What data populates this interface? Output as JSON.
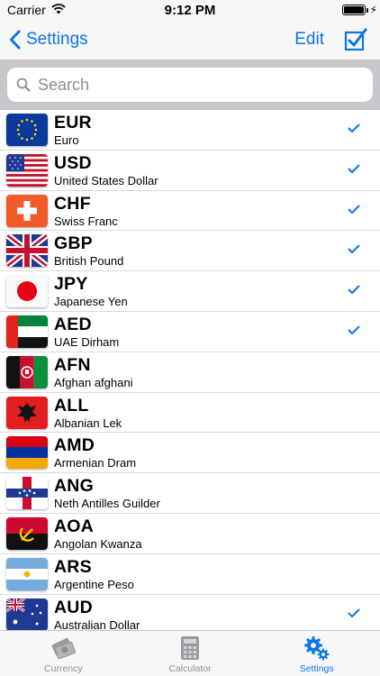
{
  "status": {
    "carrier": "Carrier",
    "time": "9:12 PM"
  },
  "nav": {
    "back_label": "Settings",
    "edit_label": "Edit"
  },
  "search": {
    "placeholder": "Search",
    "value": ""
  },
  "currencies": [
    {
      "code": "EUR",
      "name": "Euro",
      "checked": true,
      "flag": "eu-flag-icon"
    },
    {
      "code": "USD",
      "name": "United States Dollar",
      "checked": true,
      "flag": "us-flag-icon"
    },
    {
      "code": "CHF",
      "name": "Swiss Franc",
      "checked": true,
      "flag": "swiss-flag-icon"
    },
    {
      "code": "GBP",
      "name": "British Pound",
      "checked": true,
      "flag": "uk-flag-icon"
    },
    {
      "code": "JPY",
      "name": "Japanese Yen",
      "checked": true,
      "flag": "japan-flag-icon"
    },
    {
      "code": "AED",
      "name": "UAE Dirham",
      "checked": true,
      "flag": "uae-flag-icon"
    },
    {
      "code": "AFN",
      "name": "Afghan afghani",
      "checked": false,
      "flag": "afghanistan-flag-icon"
    },
    {
      "code": "ALL",
      "name": "Albanian Lek",
      "checked": false,
      "flag": "albania-flag-icon"
    },
    {
      "code": "AMD",
      "name": "Armenian Dram",
      "checked": false,
      "flag": "armenia-flag-icon"
    },
    {
      "code": "ANG",
      "name": "Neth Antilles Guilder",
      "checked": false,
      "flag": "netherlands-antilles-flag-icon"
    },
    {
      "code": "AOA",
      "name": "Angolan Kwanza",
      "checked": false,
      "flag": "angola-flag-icon"
    },
    {
      "code": "ARS",
      "name": "Argentine Peso",
      "checked": false,
      "flag": "argentina-flag-icon"
    },
    {
      "code": "AUD",
      "name": "Australian Dollar",
      "checked": true,
      "flag": "australia-flag-icon"
    }
  ],
  "tabs": [
    {
      "label": "Currency",
      "icon": "currency-icon",
      "active": false
    },
    {
      "label": "Calculator",
      "icon": "calculator-icon",
      "active": false
    },
    {
      "label": "Settings",
      "icon": "gears-icon",
      "active": true
    }
  ],
  "colors": {
    "accent": "#0a74e8",
    "inactive": "#8e8e93"
  }
}
